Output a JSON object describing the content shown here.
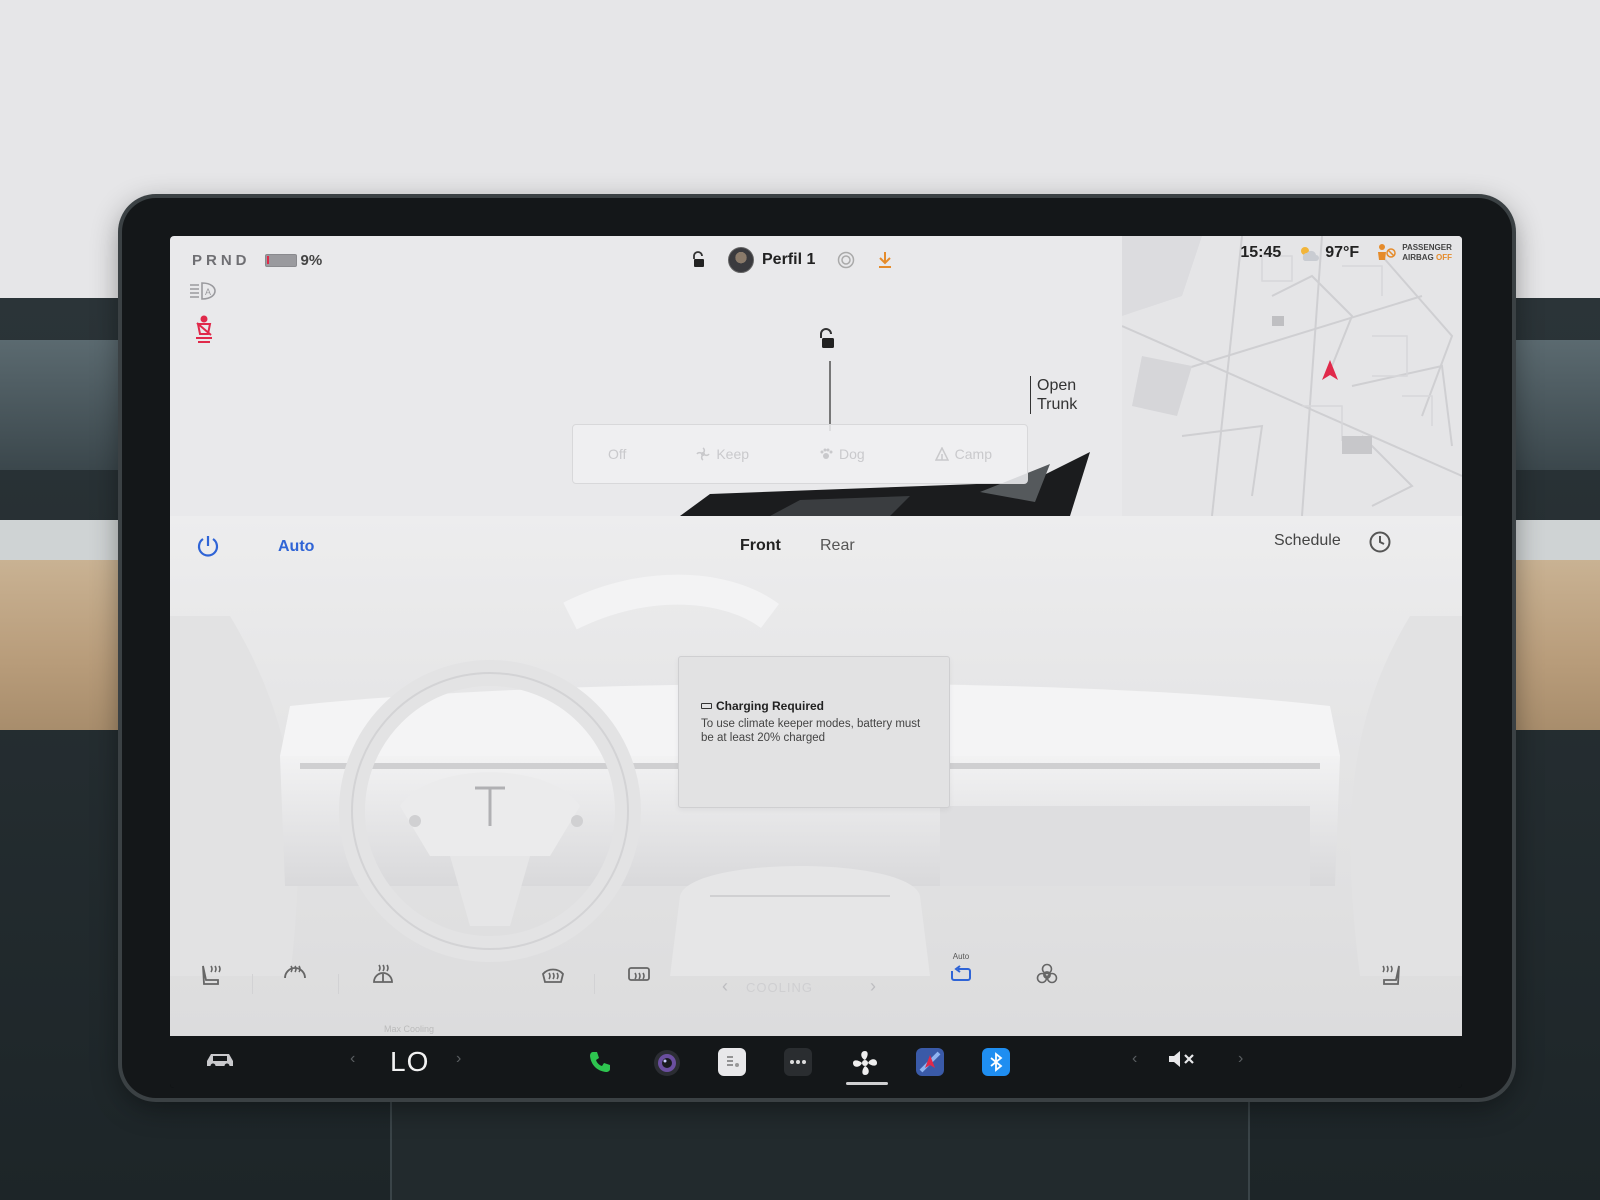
{
  "status_bar": {
    "gear": "PRND",
    "battery_percent": "9%",
    "battery_level": 0.09,
    "profile_name": "Perfil 1",
    "time": "15:45",
    "outside_temp": "97°F",
    "airbag_line1": "PASSENGER",
    "airbag_line2": "AIRBAG",
    "airbag_state": "OFF"
  },
  "car_view": {
    "trunk_line1": "Open",
    "trunk_line2": "Trunk",
    "keeper_modes": [
      "Off",
      "Keep",
      "Dog",
      "Camp"
    ]
  },
  "climate": {
    "auto_label": "Auto",
    "zone_front": "Front",
    "zone_rear": "Rear",
    "schedule_label": "Schedule",
    "fan_status": "COOLING",
    "recirc_mode_label": "Auto"
  },
  "alert": {
    "title": "Charging Required",
    "message": "To use climate keeper modes, battery must be at least 20% charged"
  },
  "dock": {
    "temp_caption": "Max Cooling",
    "temp_value": "LO"
  },
  "colors": {
    "accent_blue": "#2f64d6",
    "seatbelt_red": "#e0294a",
    "airbag_orange": "#e58b2a",
    "phone_green": "#2ec44f",
    "bluetooth_blue": "#1f8ef1",
    "download_orange": "#e58b2a"
  }
}
